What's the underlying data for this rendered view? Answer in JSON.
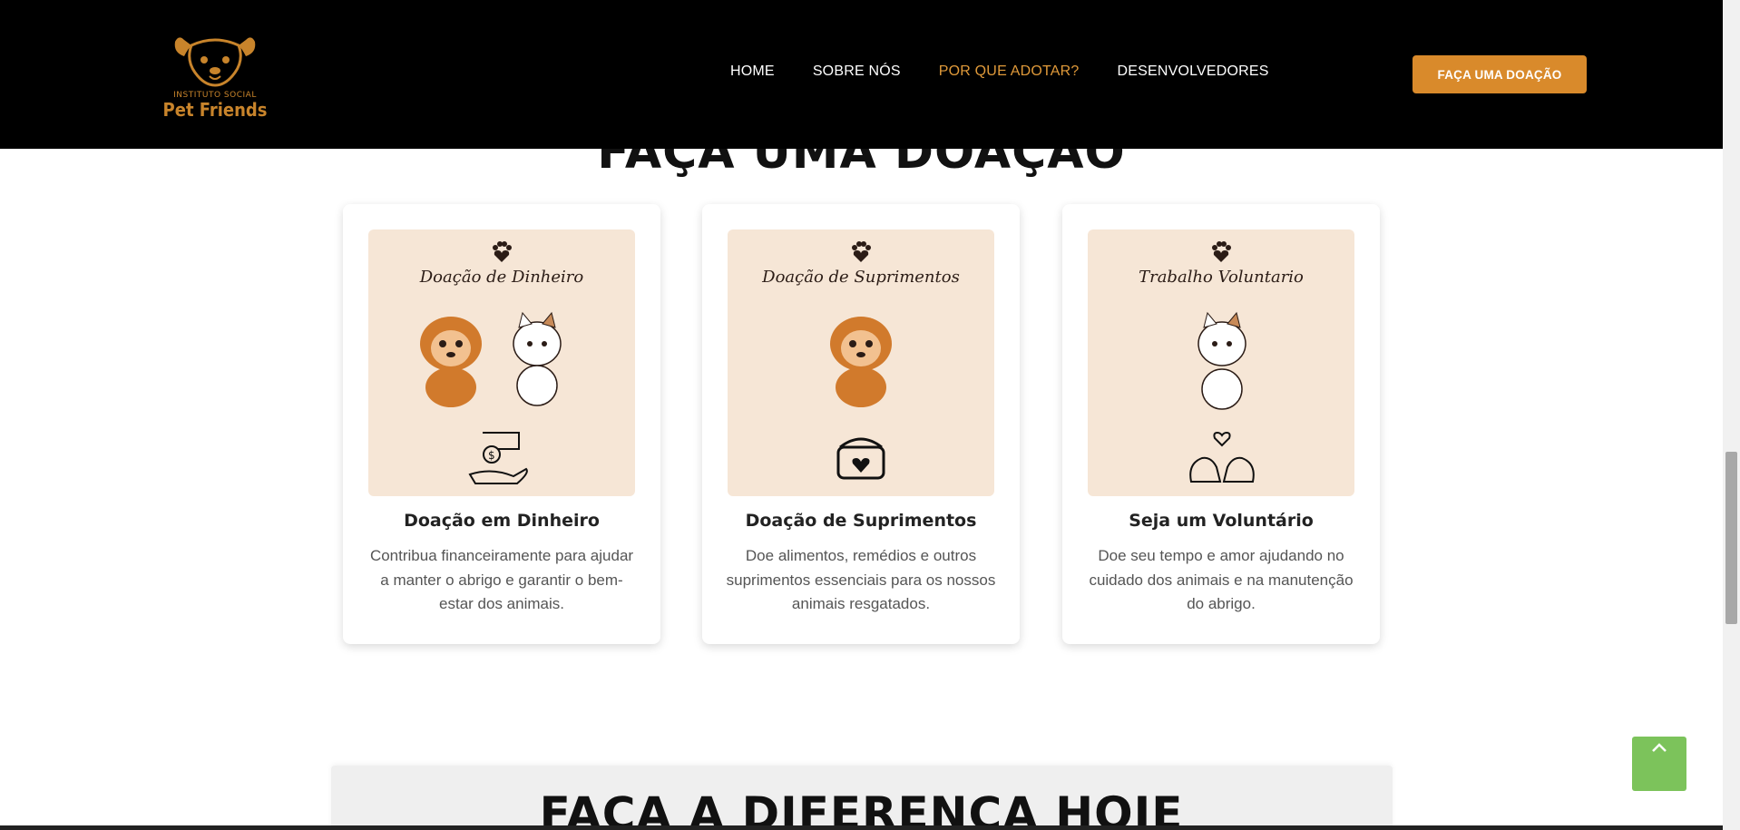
{
  "brand": {
    "small": "INSTITUTO SOCIAL",
    "big": "Pet Friends",
    "accent": "#d98a2b"
  },
  "nav": {
    "items": [
      {
        "label": "HOME",
        "active": false
      },
      {
        "label": "SOBRE NÓS",
        "active": false
      },
      {
        "label": "POR QUE ADOTAR?",
        "active": true
      },
      {
        "label": "DESENVOLVEDORES",
        "active": false
      }
    ],
    "cta": "FAÇA UMA DOAÇÃO"
  },
  "section": {
    "title": "FAÇA UMA DOAÇÃO"
  },
  "cards": [
    {
      "image_title": "Doação de Dinheiro",
      "title": "Doação em Dinheiro",
      "description": "Contribua financeiramente para ajudar a manter o abrigo e garantir o bem-estar dos animais."
    },
    {
      "image_title": "Doação de Suprimentos",
      "title": "Doação de Suprimentos",
      "description": "Doe alimentos, remédios e outros suprimentos essenciais para os nossos animais resgatados."
    },
    {
      "image_title": "Trabalho Voluntario",
      "title": "Seja um Voluntário",
      "description": "Doe seu tempo e amor ajudando no cuidado dos animais e na manutenção do abrigo."
    }
  ],
  "cta_section": {
    "title": "FAÇA A DIFERENÇA HOJE"
  },
  "icons": {
    "logo": "dog-face-icon",
    "paw": "paw-heart-icon",
    "to_top": "chevron-up-icon"
  },
  "colors": {
    "header_bg": "#000000",
    "nav_active": "#e09a3a",
    "to_top": "#7cc35b",
    "card_image_bg": "#f6e6d6"
  }
}
